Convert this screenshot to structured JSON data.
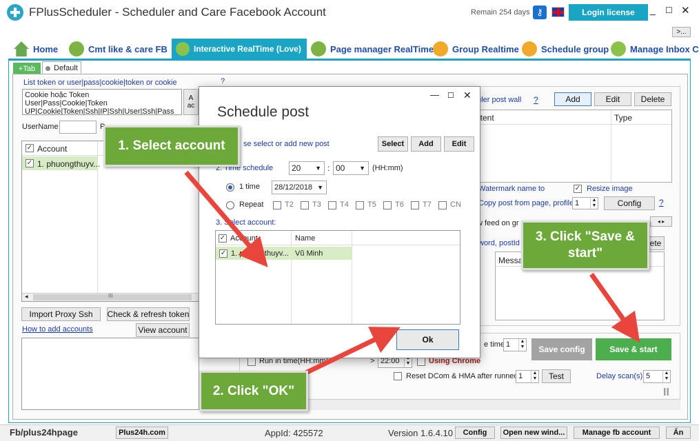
{
  "app": {
    "title": "FPlusScheduler - Scheduler and Care Facebook Account",
    "remain": "Remain 254 days",
    "login_label": "Login license",
    "more_label": ">..."
  },
  "tabs": [
    {
      "label": "Home"
    },
    {
      "label": "Cmt like & care FB"
    },
    {
      "label": "Interactive RealTime (Love)"
    },
    {
      "label": "Page manager RealTime"
    },
    {
      "label": "Group Realtime"
    },
    {
      "label": "Schedule group"
    },
    {
      "label": "Manage Inbox C"
    }
  ],
  "subtabs": {
    "add": "+Tab",
    "default": "Default"
  },
  "left": {
    "token_label": "List token or user|pass|cookie|token or cookie",
    "token_text": [
      "Cookie hoặc Token",
      "User|Pass|Cookie|Token",
      "UP|Cookie|Token|Ssh|IP|Ssh|User|Ssh|Pass"
    ],
    "side_btn": "A\nac",
    "username_label": "UserName",
    "p_label": "P",
    "col_account": "Account",
    "row_account": "1. phuongthuyv...",
    "import_proxy": "Import Proxy Ssh",
    "check_refresh": "Check & refresh token",
    "how_to": "How to add accounts",
    "view_account": "View account",
    "scroll_grip": "III"
  },
  "right": {
    "q_mark": "?",
    "scheduler_label": "duler post wall",
    "add": "Add",
    "edit": "Edit",
    "delete": "Delete",
    "col_content": "ntent",
    "col_type": "Type",
    "watermark": "Watermark name to",
    "resize": "Resize image",
    "copy_post": "Copy post from page, profile,",
    "copy_num": "1",
    "config": "Config",
    "newsfeed": "w feed on gr",
    "keyword": "word, postId",
    "delete_short": "ete",
    "col_message": "Messag",
    "time_label": "e time",
    "time_val": "1",
    "save_config": "Save config",
    "save_start": "Save & start",
    "run_in_time": "Run in time(HH:mm)",
    "to_time": "22:00",
    "using_chrome": "Using  Chrome",
    "reset_dcom": "Reset DCom & HMA after runned",
    "reset_val": "1",
    "test": "Test",
    "delay_label": "Delay scan(s)",
    "delay_val": "5",
    "pause_icon": "II"
  },
  "dialog": {
    "title": "Schedule post",
    "step1": "se select or add new post",
    "select": "Select",
    "add": "Add",
    "edit": "Edit",
    "step2": "2. Time schedule",
    "hour": "20",
    "minute": "00",
    "hhmm": "(HH:mm)",
    "once": "1 time",
    "date": "28/12/2018",
    "repeat": "Repeat",
    "days": [
      "T2",
      "T3",
      "T4",
      "T5",
      "T6",
      "T7",
      "CN"
    ],
    "step3": "3. Select account:",
    "col_account": "Account",
    "col_name": "Name",
    "row_account": "1. phuongthuyv...",
    "row_name": "Vũ Minh",
    "ok": "Ok"
  },
  "callouts": {
    "c1": "1. Select account",
    "c2": "2. Click \"OK\"",
    "c3": "3. Click \"Save & start\""
  },
  "status": {
    "fb": "Fb/plus24hpage",
    "site": "Plus24h.com",
    "appid": "AppId: 425572",
    "version": "Version 1.6.4.10",
    "config": "Config",
    "open_new": "Open new wind...",
    "manage_fb": "Manage fb account",
    "hide": "Ẩn"
  },
  "colors": {
    "accent": "#1ba5c4",
    "tab_active": "#1ba5c4",
    "green": "#5cb85c",
    "callout": "#6ca83a",
    "arrow": "#e8453c"
  }
}
